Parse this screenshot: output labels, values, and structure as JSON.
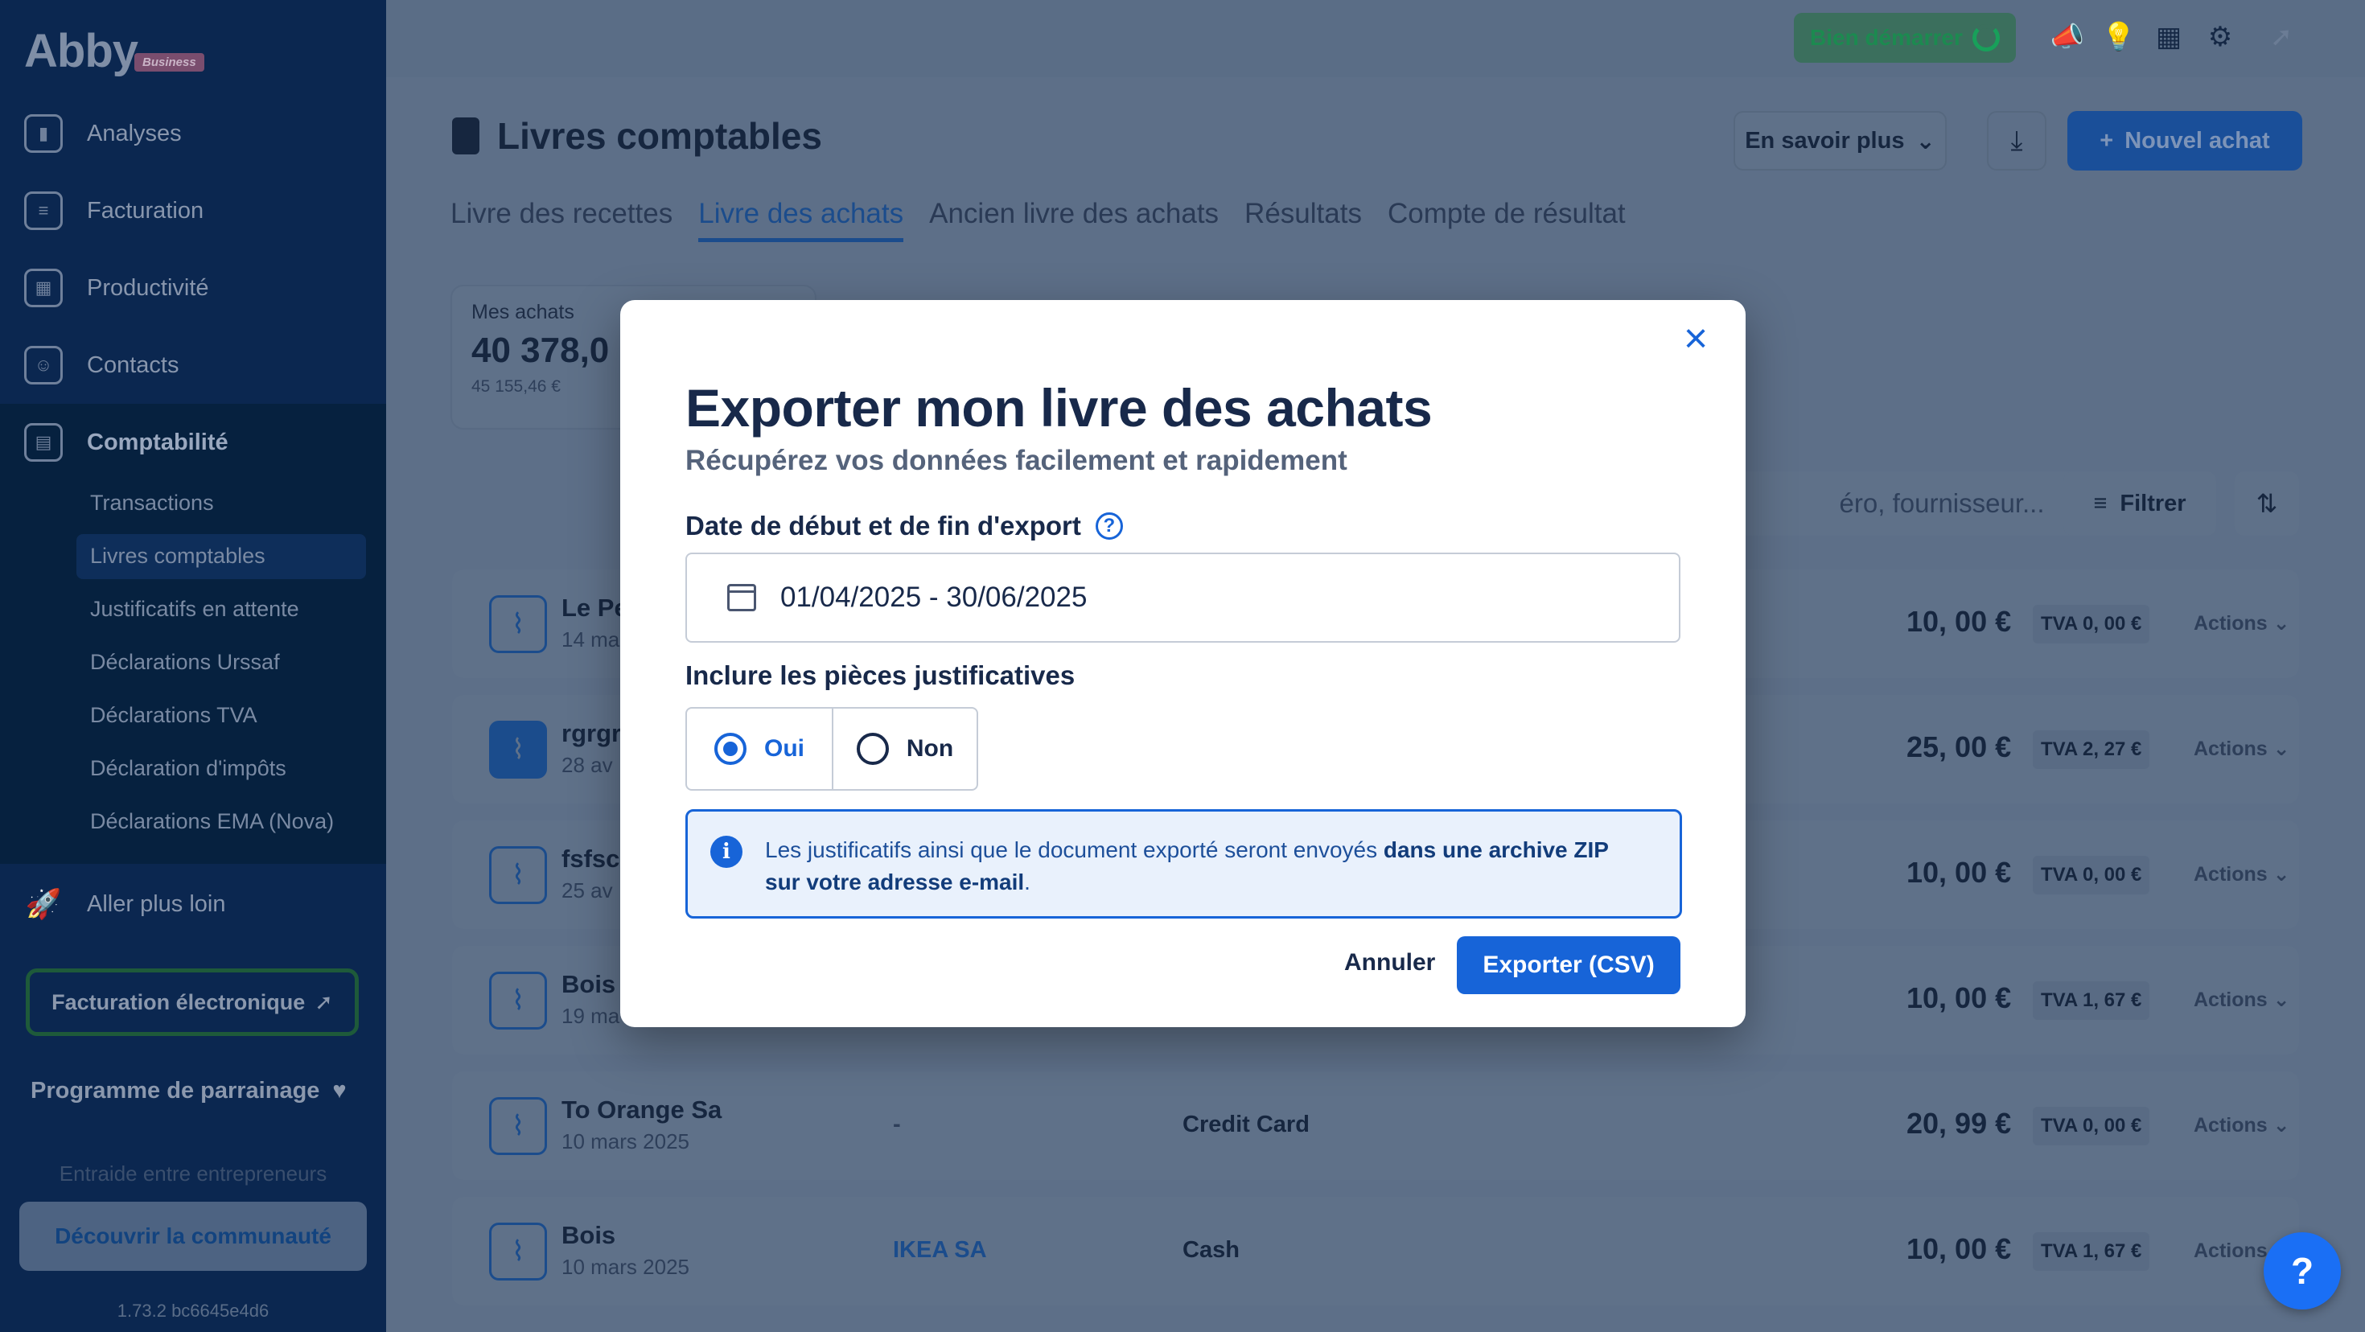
{
  "brand": {
    "name": "Abby",
    "tag": "Business"
  },
  "sidebar": {
    "items": [
      {
        "label": "Analyses",
        "icon": "chart-icon"
      },
      {
        "label": "Facturation",
        "icon": "document-icon"
      },
      {
        "label": "Productivité",
        "icon": "grid-icon"
      },
      {
        "label": "Contacts",
        "icon": "users-icon"
      },
      {
        "label": "Comptabilité",
        "icon": "calculator-icon"
      }
    ],
    "sub_items": [
      "Transactions",
      "Livres comptables",
      "Justificatifs en attente",
      "Déclarations Urssaf",
      "Déclarations TVA",
      "Déclaration d'impôts",
      "Déclarations EMA (Nova)"
    ],
    "aller_plus_loin": "Aller plus loin",
    "facturation_electronique": "Facturation électronique",
    "parrainage": "Programme de parrainage",
    "entraide": "Entraide entre entrepreneurs",
    "decouvrir": "Découvrir la communauté",
    "version": "1.73.2 bc6645e4d6"
  },
  "topbar": {
    "bien_demarrer": "Bien démarrer"
  },
  "header": {
    "title": "Livres comptables",
    "en_savoir_plus": "En savoir plus",
    "nouvel_achat": "Nouvel achat"
  },
  "tabs": [
    "Livre des recettes",
    "Livre des achats",
    "Ancien livre des achats",
    "Résultats",
    "Compte de résultat"
  ],
  "kpi": {
    "label": "Mes achats",
    "value": "40 378,0",
    "sub": "45 155,46 €"
  },
  "search": {
    "placeholder": "éro, fournisseur..."
  },
  "filter_label": "Filtrer",
  "rows": [
    {
      "name": "Le Pe",
      "date": "14 ma",
      "supplier": "",
      "payment": "",
      "amount": "10, 00 €",
      "tva": "TVA  0, 00 €",
      "action": "Actions"
    },
    {
      "name": "rgrgr",
      "date": "28 av",
      "supplier": "",
      "payment": "",
      "amount": "25, 00 €",
      "tva": "TVA  2, 27 €",
      "action": "Actions"
    },
    {
      "name": "fsfsc",
      "date": "25 av",
      "supplier": "",
      "payment": "",
      "amount": "10, 00 €",
      "tva": "TVA  0, 00 €",
      "action": "Actions"
    },
    {
      "name": "Bois",
      "date": "19 ma",
      "supplier": "",
      "payment": "",
      "amount": "10, 00 €",
      "tva": "TVA  1, 67 €",
      "action": "Actions"
    },
    {
      "name": "To Orange Sa",
      "date": "10 mars 2025",
      "supplier": "-",
      "payment": "Credit Card",
      "amount": "20, 99 €",
      "tva": "TVA  0, 00 €",
      "action": "Actions"
    },
    {
      "name": "Bois",
      "date": "10 mars 2025",
      "supplier": "IKEA SA",
      "payment": "Cash",
      "amount": "10, 00 €",
      "tva": "TVA  1, 67 €",
      "action": "Actions"
    }
  ],
  "modal": {
    "title": "Exporter mon livre des achats",
    "subtitle": "Récupérez vos données facilement et rapidement",
    "date_label": "Date de début et de fin d'export",
    "date_value": "01/04/2025 - 30/06/2025",
    "pieces_label": "Inclure les pièces justificatives",
    "oui": "Oui",
    "non": "Non",
    "info_text": "Les justificatifs ainsi que le document exporté seront envoyés ",
    "info_bold": "dans une archive ZIP sur votre adresse e-mail",
    "info_end": ".",
    "annuler": "Annuler",
    "exporter": "Exporter (CSV)"
  },
  "help": "?"
}
